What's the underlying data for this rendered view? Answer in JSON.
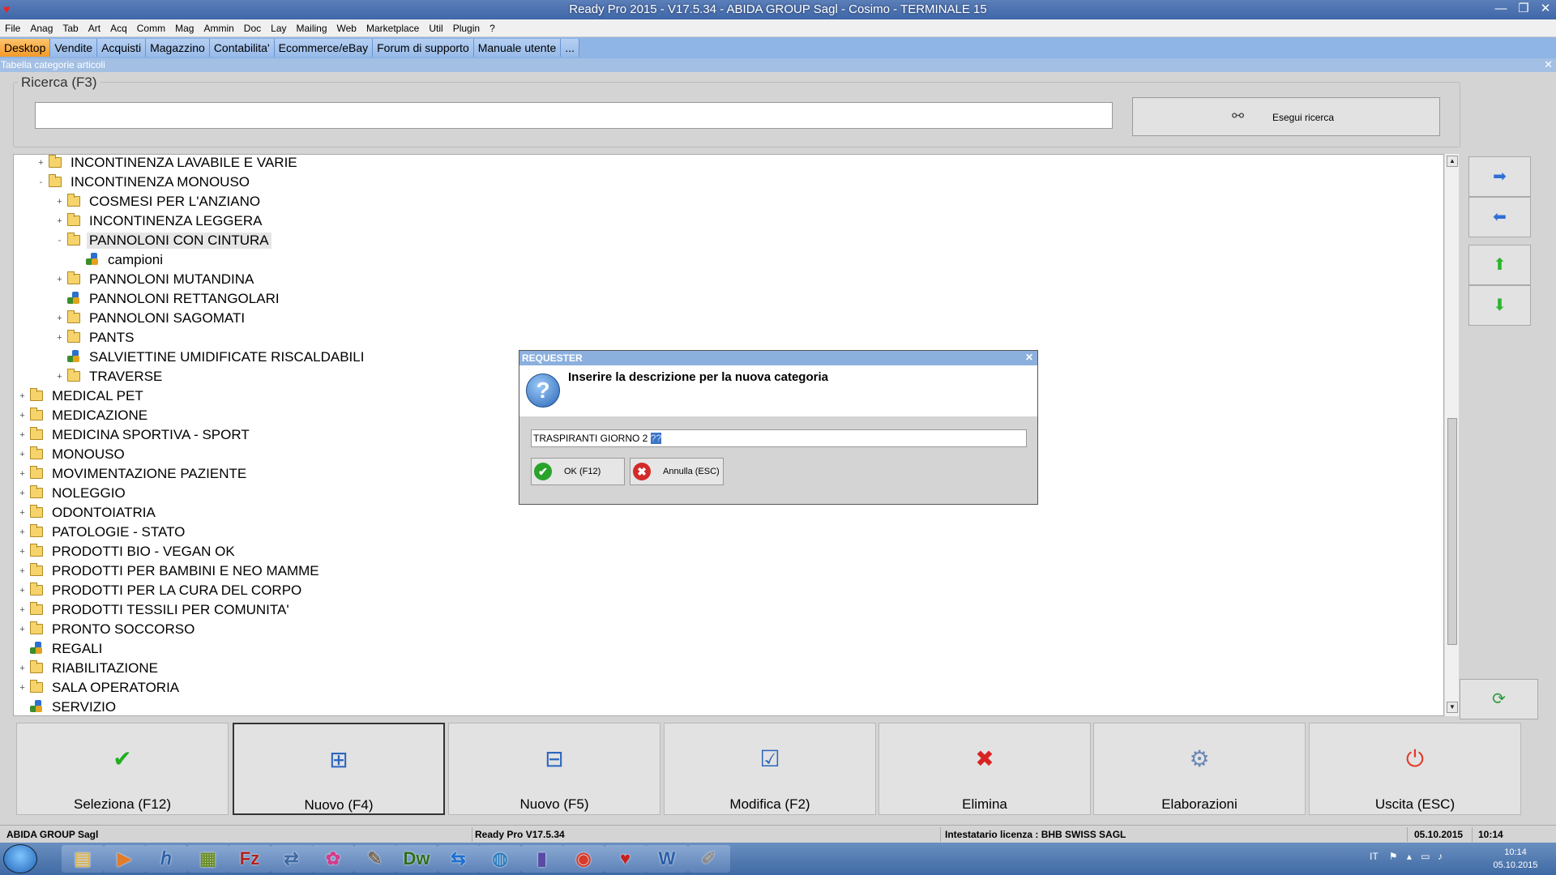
{
  "window": {
    "title": "Ready Pro 2015 - V17.5.34 - ABIDA GROUP Sagl - Cosimo - TERMINALE 15"
  },
  "menu": [
    "File",
    "Anag",
    "Tab",
    "Art",
    "Acq",
    "Comm",
    "Mag",
    "Ammin",
    "Doc",
    "Lay",
    "Mailing",
    "Web",
    "Marketplace",
    "Util",
    "Plugin",
    "?"
  ],
  "tabs": [
    "Desktop",
    "Vendite",
    "Acquisti",
    "Magazzino",
    "Contabilita'",
    "Ecommerce/eBay",
    "Forum di supporto",
    "Manuale utente",
    "..."
  ],
  "panel": {
    "title": "Tabella categorie articoli"
  },
  "search": {
    "legend": "Ricerca (F3)",
    "value": "",
    "button_label": "Esegui ricerca"
  },
  "tree": [
    {
      "label": "INCONTINENZA LAVABILE E VARIE",
      "level": 1,
      "expander": "+",
      "icon": "folder"
    },
    {
      "label": "INCONTINENZA MONOUSO",
      "level": 1,
      "expander": "-",
      "icon": "folder"
    },
    {
      "label": "COSMESI PER L'ANZIANO",
      "level": 2,
      "expander": "+",
      "icon": "folder"
    },
    {
      "label": "INCONTINENZA LEGGERA",
      "level": 2,
      "expander": "+",
      "icon": "folder"
    },
    {
      "label": "PANNOLONI CON CINTURA",
      "level": 2,
      "expander": "-",
      "icon": "folder",
      "selected": true
    },
    {
      "label": "campioni",
      "level": 3,
      "expander": "",
      "icon": "category"
    },
    {
      "label": "PANNOLONI MUTANDINA",
      "level": 2,
      "expander": "+",
      "icon": "folder"
    },
    {
      "label": "PANNOLONI RETTANGOLARI",
      "level": 2,
      "expander": "",
      "icon": "category"
    },
    {
      "label": "PANNOLONI SAGOMATI",
      "level": 2,
      "expander": "+",
      "icon": "folder"
    },
    {
      "label": "PANTS",
      "level": 2,
      "expander": "+",
      "icon": "folder"
    },
    {
      "label": "SALVIETTINE UMIDIFICATE RISCALDABILI",
      "level": 2,
      "expander": "",
      "icon": "category"
    },
    {
      "label": "TRAVERSE",
      "level": 2,
      "expander": "+",
      "icon": "folder"
    },
    {
      "label": "MEDICAL PET",
      "level": 0,
      "expander": "+",
      "icon": "folder"
    },
    {
      "label": "MEDICAZIONE",
      "level": 0,
      "expander": "+",
      "icon": "folder"
    },
    {
      "label": "MEDICINA SPORTIVA - SPORT",
      "level": 0,
      "expander": "+",
      "icon": "folder"
    },
    {
      "label": "MONOUSO",
      "level": 0,
      "expander": "+",
      "icon": "folder"
    },
    {
      "label": "MOVIMENTAZIONE PAZIENTE",
      "level": 0,
      "expander": "+",
      "icon": "folder"
    },
    {
      "label": "NOLEGGIO",
      "level": 0,
      "expander": "+",
      "icon": "folder"
    },
    {
      "label": "ODONTOIATRIA",
      "level": 0,
      "expander": "+",
      "icon": "folder"
    },
    {
      "label": "PATOLOGIE - STATO",
      "level": 0,
      "expander": "+",
      "icon": "folder"
    },
    {
      "label": "PRODOTTI BIO - VEGAN OK",
      "level": 0,
      "expander": "+",
      "icon": "folder"
    },
    {
      "label": "PRODOTTI PER BAMBINI E NEO MAMME",
      "level": 0,
      "expander": "+",
      "icon": "folder"
    },
    {
      "label": "PRODOTTI PER LA CURA DEL CORPO",
      "level": 0,
      "expander": "+",
      "icon": "folder"
    },
    {
      "label": "PRODOTTI TESSILI PER COMUNITA'",
      "level": 0,
      "expander": "+",
      "icon": "folder"
    },
    {
      "label": "PRONTO SOCCORSO",
      "level": 0,
      "expander": "+",
      "icon": "folder"
    },
    {
      "label": "REGALI",
      "level": 0,
      "expander": "",
      "icon": "category"
    },
    {
      "label": "RIABILITAZIONE",
      "level": 0,
      "expander": "+",
      "icon": "folder"
    },
    {
      "label": "SALA OPERATORIA",
      "level": 0,
      "expander": "+",
      "icon": "folder"
    },
    {
      "label": "SERVIZIO",
      "level": 0,
      "expander": "",
      "icon": "category"
    }
  ],
  "nav_buttons": [
    {
      "icon": "arrow-right-icon",
      "glyph": "➡",
      "color": "#2f6fd6"
    },
    {
      "icon": "arrow-left-icon",
      "glyph": "⬅",
      "color": "#2f6fd6"
    },
    {
      "icon": "arrow-up-icon",
      "glyph": "⬆",
      "color": "#2fb52f"
    },
    {
      "icon": "arrow-down-icon",
      "glyph": "⬇",
      "color": "#2fb52f"
    },
    {
      "icon": "refresh-icon",
      "glyph": "⟳",
      "color": "#2a9a3a"
    }
  ],
  "bottom_buttons": [
    {
      "label": "Seleziona (F12)",
      "icon": "check-icon",
      "glyph": "✔",
      "color": "#1fae1f"
    },
    {
      "label": "Nuovo (F4)",
      "icon": "new-tree-node-icon",
      "glyph": "⊞",
      "color": "#2b65c0"
    },
    {
      "label": "Nuovo (F5)",
      "icon": "new-child-node-icon",
      "glyph": "⊟",
      "color": "#2b65c0"
    },
    {
      "label": "Modifica (F2)",
      "icon": "edit-icon",
      "glyph": "☑",
      "color": "#2b65c0"
    },
    {
      "label": "Elimina",
      "icon": "delete-icon",
      "glyph": "✖",
      "color": "#d92323"
    },
    {
      "label": "Elaborazioni",
      "icon": "process-icon",
      "glyph": "⚙",
      "color": "#6b88b5"
    },
    {
      "label": "Uscita (ESC)",
      "icon": "power-icon",
      "glyph": "⏻",
      "color": "#e03a2a"
    }
  ],
  "status": {
    "company": "ABIDA GROUP Sagl",
    "version": "Ready Pro V17.5.34",
    "license": "Intestatario licenza : BHB SWISS SAGL",
    "date": "05.10.2015",
    "time": "10:14"
  },
  "dialog": {
    "title": "REQUESTER",
    "message": "Inserire la descrizione per la nuova categoria",
    "input_value": "TRASPIRANTI GIORNO 2 ",
    "input_selected": "??",
    "ok_label": "OK (F12)",
    "cancel_label": "Annulla (ESC)"
  },
  "taskbar": {
    "clock_time": "10:14",
    "clock_date": "05.10.2015",
    "lang": "IT",
    "apps": [
      {
        "icon": "explorer-icon",
        "glyph": "▤",
        "color": "#d9b45a"
      },
      {
        "icon": "media-player-icon",
        "glyph": "▶",
        "color": "#e27c2a"
      },
      {
        "icon": "hp-icon",
        "glyph": "ℎ",
        "color": "#2a5ea6"
      },
      {
        "icon": "tools-icon",
        "glyph": "▦",
        "color": "#6b8e2a"
      },
      {
        "icon": "filezilla-icon",
        "glyph": "Fz",
        "color": "#b3211c"
      },
      {
        "icon": "network-icon",
        "glyph": "⇄",
        "color": "#3f6aa4"
      },
      {
        "icon": "picasa-icon",
        "glyph": "✿",
        "color": "#d43b8a"
      },
      {
        "icon": "gimp-icon",
        "glyph": "✎",
        "color": "#7a6a5a"
      },
      {
        "icon": "dreamweaver-icon",
        "glyph": "Dw",
        "color": "#2f6e1a"
      },
      {
        "icon": "teamviewer-icon",
        "glyph": "⇆",
        "color": "#1e6fd1"
      },
      {
        "icon": "globe-icon",
        "glyph": "◍",
        "color": "#2a7bbd"
      },
      {
        "icon": "chart-icon",
        "glyph": "▮",
        "color": "#5a4aa6"
      },
      {
        "icon": "chrome-icon",
        "glyph": "◉",
        "color": "#d93a2a"
      },
      {
        "icon": "readypro-icon",
        "glyph": "♥",
        "color": "#c8201f"
      },
      {
        "icon": "word-icon",
        "glyph": "W",
        "color": "#2a5ea6"
      },
      {
        "icon": "paint-icon",
        "glyph": "✐",
        "color": "#8a8a8a"
      }
    ]
  }
}
